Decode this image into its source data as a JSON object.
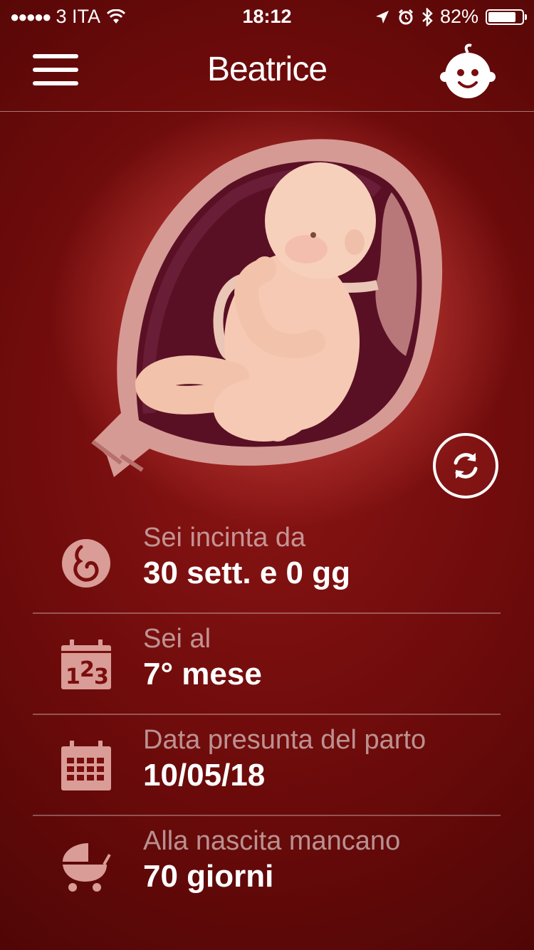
{
  "status_bar": {
    "signal_dots": "●●●●●",
    "carrier": "3 ITA",
    "time": "18:12",
    "battery": "82%",
    "battery_level": 0.82,
    "icons": [
      "wifi-icon",
      "location-icon",
      "alarm-icon",
      "bluetooth-icon",
      "battery-icon"
    ]
  },
  "header": {
    "title": "Beatrice",
    "menu_icon": "hamburger-menu-icon",
    "profile_icon": "baby-face-icon"
  },
  "illustration": {
    "icon": "fetus-illustration",
    "refresh_icon": "refresh-icon"
  },
  "info": {
    "items": [
      {
        "label": "Sei incinta da",
        "value": "30 sett. e 0 gg",
        "icon": "pregnancy-icon"
      },
      {
        "label": "Sei al",
        "value": "7° mese",
        "icon": "calendar-123-icon"
      },
      {
        "label": "Data presunta del parto",
        "value": "10/05/18",
        "icon": "calendar-grid-icon"
      },
      {
        "label": "Alla nascita mancano",
        "value": "70 giorni",
        "icon": "baby-stroller-icon"
      }
    ]
  },
  "colors": {
    "background": "#7a0d0d",
    "glow": "#c2423a",
    "text": "#ffffff",
    "muted_text": "#e8b0ad"
  }
}
